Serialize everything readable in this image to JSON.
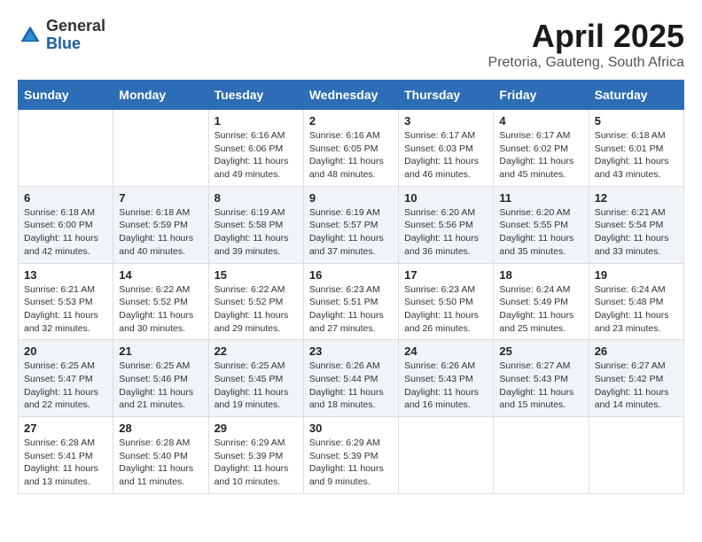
{
  "logo": {
    "general": "General",
    "blue": "Blue"
  },
  "title": "April 2025",
  "subtitle": "Pretoria, Gauteng, South Africa",
  "days_of_week": [
    "Sunday",
    "Monday",
    "Tuesday",
    "Wednesday",
    "Thursday",
    "Friday",
    "Saturday"
  ],
  "weeks": [
    [
      {
        "day": "",
        "info": ""
      },
      {
        "day": "",
        "info": ""
      },
      {
        "day": "1",
        "info": "Sunrise: 6:16 AM\nSunset: 6:06 PM\nDaylight: 11 hours and 49 minutes."
      },
      {
        "day": "2",
        "info": "Sunrise: 6:16 AM\nSunset: 6:05 PM\nDaylight: 11 hours and 48 minutes."
      },
      {
        "day": "3",
        "info": "Sunrise: 6:17 AM\nSunset: 6:03 PM\nDaylight: 11 hours and 46 minutes."
      },
      {
        "day": "4",
        "info": "Sunrise: 6:17 AM\nSunset: 6:02 PM\nDaylight: 11 hours and 45 minutes."
      },
      {
        "day": "5",
        "info": "Sunrise: 6:18 AM\nSunset: 6:01 PM\nDaylight: 11 hours and 43 minutes."
      }
    ],
    [
      {
        "day": "6",
        "info": "Sunrise: 6:18 AM\nSunset: 6:00 PM\nDaylight: 11 hours and 42 minutes."
      },
      {
        "day": "7",
        "info": "Sunrise: 6:18 AM\nSunset: 5:59 PM\nDaylight: 11 hours and 40 minutes."
      },
      {
        "day": "8",
        "info": "Sunrise: 6:19 AM\nSunset: 5:58 PM\nDaylight: 11 hours and 39 minutes."
      },
      {
        "day": "9",
        "info": "Sunrise: 6:19 AM\nSunset: 5:57 PM\nDaylight: 11 hours and 37 minutes."
      },
      {
        "day": "10",
        "info": "Sunrise: 6:20 AM\nSunset: 5:56 PM\nDaylight: 11 hours and 36 minutes."
      },
      {
        "day": "11",
        "info": "Sunrise: 6:20 AM\nSunset: 5:55 PM\nDaylight: 11 hours and 35 minutes."
      },
      {
        "day": "12",
        "info": "Sunrise: 6:21 AM\nSunset: 5:54 PM\nDaylight: 11 hours and 33 minutes."
      }
    ],
    [
      {
        "day": "13",
        "info": "Sunrise: 6:21 AM\nSunset: 5:53 PM\nDaylight: 11 hours and 32 minutes."
      },
      {
        "day": "14",
        "info": "Sunrise: 6:22 AM\nSunset: 5:52 PM\nDaylight: 11 hours and 30 minutes."
      },
      {
        "day": "15",
        "info": "Sunrise: 6:22 AM\nSunset: 5:52 PM\nDaylight: 11 hours and 29 minutes."
      },
      {
        "day": "16",
        "info": "Sunrise: 6:23 AM\nSunset: 5:51 PM\nDaylight: 11 hours and 27 minutes."
      },
      {
        "day": "17",
        "info": "Sunrise: 6:23 AM\nSunset: 5:50 PM\nDaylight: 11 hours and 26 minutes."
      },
      {
        "day": "18",
        "info": "Sunrise: 6:24 AM\nSunset: 5:49 PM\nDaylight: 11 hours and 25 minutes."
      },
      {
        "day": "19",
        "info": "Sunrise: 6:24 AM\nSunset: 5:48 PM\nDaylight: 11 hours and 23 minutes."
      }
    ],
    [
      {
        "day": "20",
        "info": "Sunrise: 6:25 AM\nSunset: 5:47 PM\nDaylight: 11 hours and 22 minutes."
      },
      {
        "day": "21",
        "info": "Sunrise: 6:25 AM\nSunset: 5:46 PM\nDaylight: 11 hours and 21 minutes."
      },
      {
        "day": "22",
        "info": "Sunrise: 6:25 AM\nSunset: 5:45 PM\nDaylight: 11 hours and 19 minutes."
      },
      {
        "day": "23",
        "info": "Sunrise: 6:26 AM\nSunset: 5:44 PM\nDaylight: 11 hours and 18 minutes."
      },
      {
        "day": "24",
        "info": "Sunrise: 6:26 AM\nSunset: 5:43 PM\nDaylight: 11 hours and 16 minutes."
      },
      {
        "day": "25",
        "info": "Sunrise: 6:27 AM\nSunset: 5:43 PM\nDaylight: 11 hours and 15 minutes."
      },
      {
        "day": "26",
        "info": "Sunrise: 6:27 AM\nSunset: 5:42 PM\nDaylight: 11 hours and 14 minutes."
      }
    ],
    [
      {
        "day": "27",
        "info": "Sunrise: 6:28 AM\nSunset: 5:41 PM\nDaylight: 11 hours and 13 minutes."
      },
      {
        "day": "28",
        "info": "Sunrise: 6:28 AM\nSunset: 5:40 PM\nDaylight: 11 hours and 11 minutes."
      },
      {
        "day": "29",
        "info": "Sunrise: 6:29 AM\nSunset: 5:39 PM\nDaylight: 11 hours and 10 minutes."
      },
      {
        "day": "30",
        "info": "Sunrise: 6:29 AM\nSunset: 5:39 PM\nDaylight: 11 hours and 9 minutes."
      },
      {
        "day": "",
        "info": ""
      },
      {
        "day": "",
        "info": ""
      },
      {
        "day": "",
        "info": ""
      }
    ]
  ]
}
